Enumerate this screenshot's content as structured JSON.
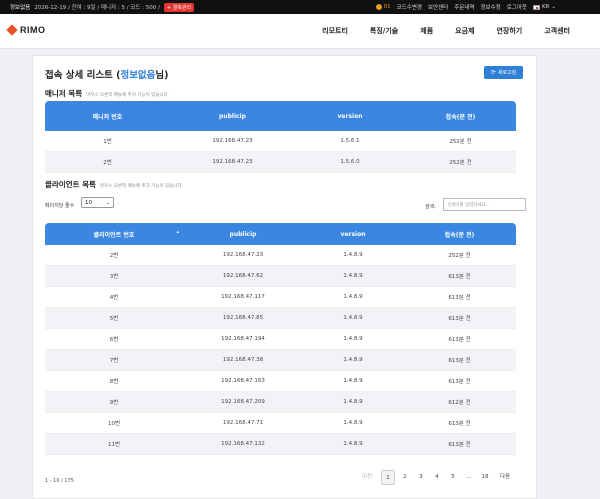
{
  "topbar": {
    "user": "정보없음",
    "info": "2026-12-19 / 잔여 : 9일 / 매니저 : 5 / 코드 : 500 /",
    "badge": "+ 결축관리",
    "notif_count": "01",
    "links": [
      "코드수변경",
      "보안센터",
      "주문내역",
      "정보수정",
      "로그아웃"
    ],
    "lang": "KR"
  },
  "logo": "RIMO",
  "nav": [
    "리모트티",
    "특징/기술",
    "제품",
    "요금제",
    "연장하기",
    "고객센터"
  ],
  "page": {
    "title_prefix": "접속 상세 리스트 (",
    "title_highlight": "정보없음",
    "title_suffix": "님)",
    "refresh": "새로고침"
  },
  "managers": {
    "title": "매니저 목록",
    "hint": "마우스 오른쪽 메뉴에 추가 기능이 있습니다.",
    "headers": [
      "매니저 번호",
      "publicip",
      "version",
      "접속(분 전)"
    ],
    "rows": [
      [
        "1번",
        "192.168.47.23",
        "1.5.6.1",
        "252분 전"
      ],
      [
        "2번",
        "192.168.47.23",
        "1.5.6.0",
        "252분 전"
      ]
    ]
  },
  "clients": {
    "title": "클라이언트 목록",
    "hint": "마우스 오른쪽 메뉴에 추가 기능이 있습니다.",
    "per_page_label": "페이지당 줄수",
    "per_page_value": "10",
    "search_label": "검색:",
    "search_placeholder": "검색어를 입력하세요...",
    "headers": [
      "클라이언트 번호",
      "publicip",
      "version",
      "접속(분 전)"
    ],
    "rows": [
      [
        "2번",
        "192.168.47.23",
        "1.4.8.9",
        "252분 전"
      ],
      [
        "3번",
        "192.168.47.62",
        "1.4.8.9",
        "613분 전"
      ],
      [
        "4번",
        "192.168.47.117",
        "1.4.8.9",
        "613분 전"
      ],
      [
        "5번",
        "192.168.47.85",
        "1.4.8.9",
        "613분 전"
      ],
      [
        "6번",
        "192.168.47.194",
        "1.4.8.9",
        "613분 전"
      ],
      [
        "7번",
        "192.168.47.38",
        "1.4.8.9",
        "613분 전"
      ],
      [
        "8번",
        "192.168.47.163",
        "1.4.8.9",
        "613분 전"
      ],
      [
        "9번",
        "192.168.47.209",
        "1.4.8.9",
        "612분 전"
      ],
      [
        "10번",
        "192.168.47.71",
        "1.4.8.9",
        "613분 전"
      ],
      [
        "11번",
        "192.168.47.132",
        "1.4.8.9",
        "613분 전"
      ]
    ],
    "info": "1 - 10 / 175",
    "pager": {
      "prev": "이전",
      "pages": [
        "1",
        "2",
        "3",
        "4",
        "5",
        "...",
        "18"
      ],
      "active": "1",
      "next": "다음"
    }
  }
}
